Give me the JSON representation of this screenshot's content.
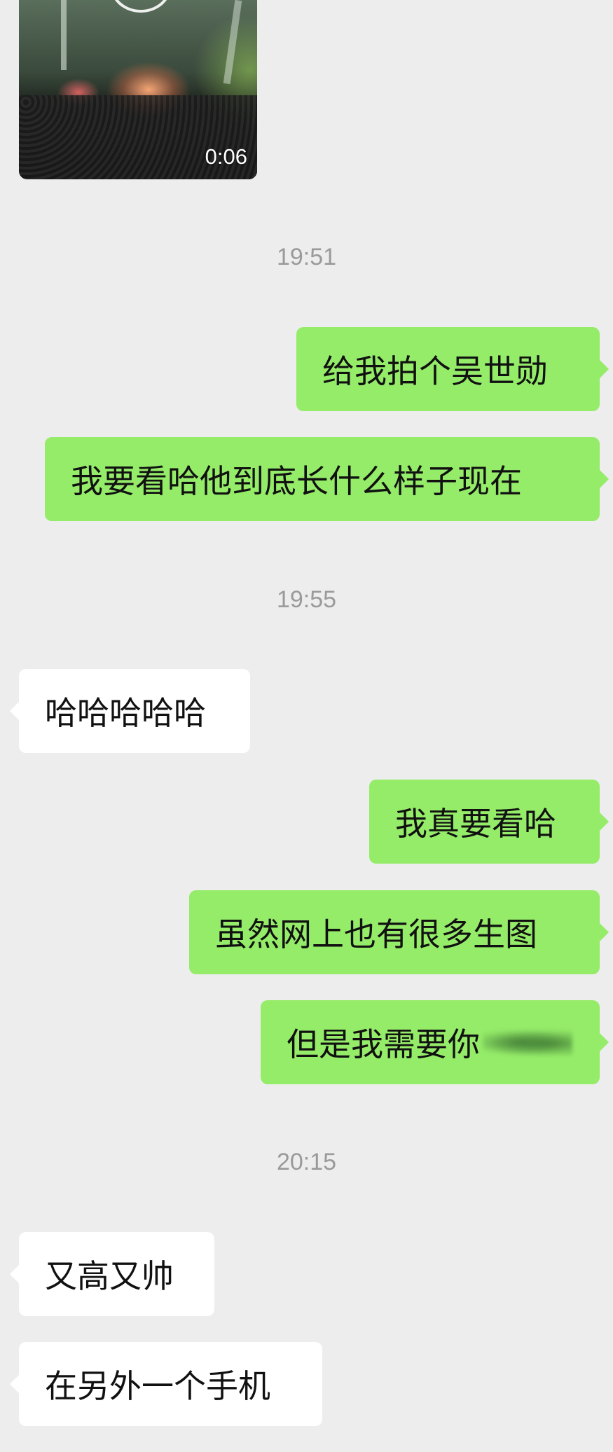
{
  "video": {
    "duration": "0:06"
  },
  "timestamps": [
    "19:51",
    "19:55",
    "20:15"
  ],
  "messages": [
    {
      "side": "sent",
      "text": "给我拍个吴世勋"
    },
    {
      "side": "sent",
      "text": "我要看哈他到底长什么样子现在"
    },
    {
      "side": "recv",
      "text": "哈哈哈哈哈"
    },
    {
      "side": "sent",
      "text": "我真要看哈"
    },
    {
      "side": "sent",
      "text": "虽然网上也有很多生图"
    },
    {
      "side": "sent",
      "text": "但是我需要你"
    },
    {
      "side": "recv",
      "text": "又高又帅"
    },
    {
      "side": "recv",
      "text": "在另外一个手机"
    }
  ],
  "colors": {
    "sent_bubble": "#95ec69",
    "recv_bubble": "#ffffff",
    "background": "#ededed",
    "timestamp": "#9a9a9a"
  }
}
